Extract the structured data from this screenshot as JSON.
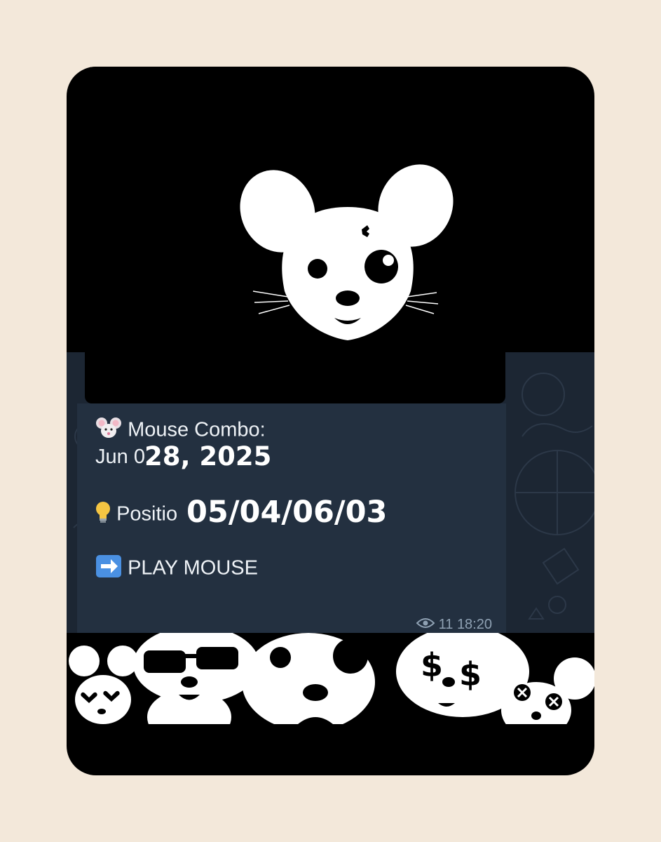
{
  "message": {
    "title_line": "Mouse Combo:",
    "date_prefix": "Jun 0",
    "date_overlay": "28, 2025",
    "position_label": "Positio",
    "position_overlay": "05/04/06/03",
    "play_label": "PLAY MOUSE",
    "views": "11",
    "time": "18:20"
  },
  "icons": {
    "title": "mouse-face-icon",
    "position": "light-bulb-icon",
    "play": "right-arrow-icon",
    "views": "eye-icon",
    "logo": "mouse-mascot-logo"
  },
  "colors": {
    "page_bg": "#f3e8da",
    "card_bg": "#000000",
    "bubble_bg": "#233040",
    "chat_bg": "#1c2633",
    "arrow_box": "#4a90e2",
    "bulb": "#f5c542"
  }
}
